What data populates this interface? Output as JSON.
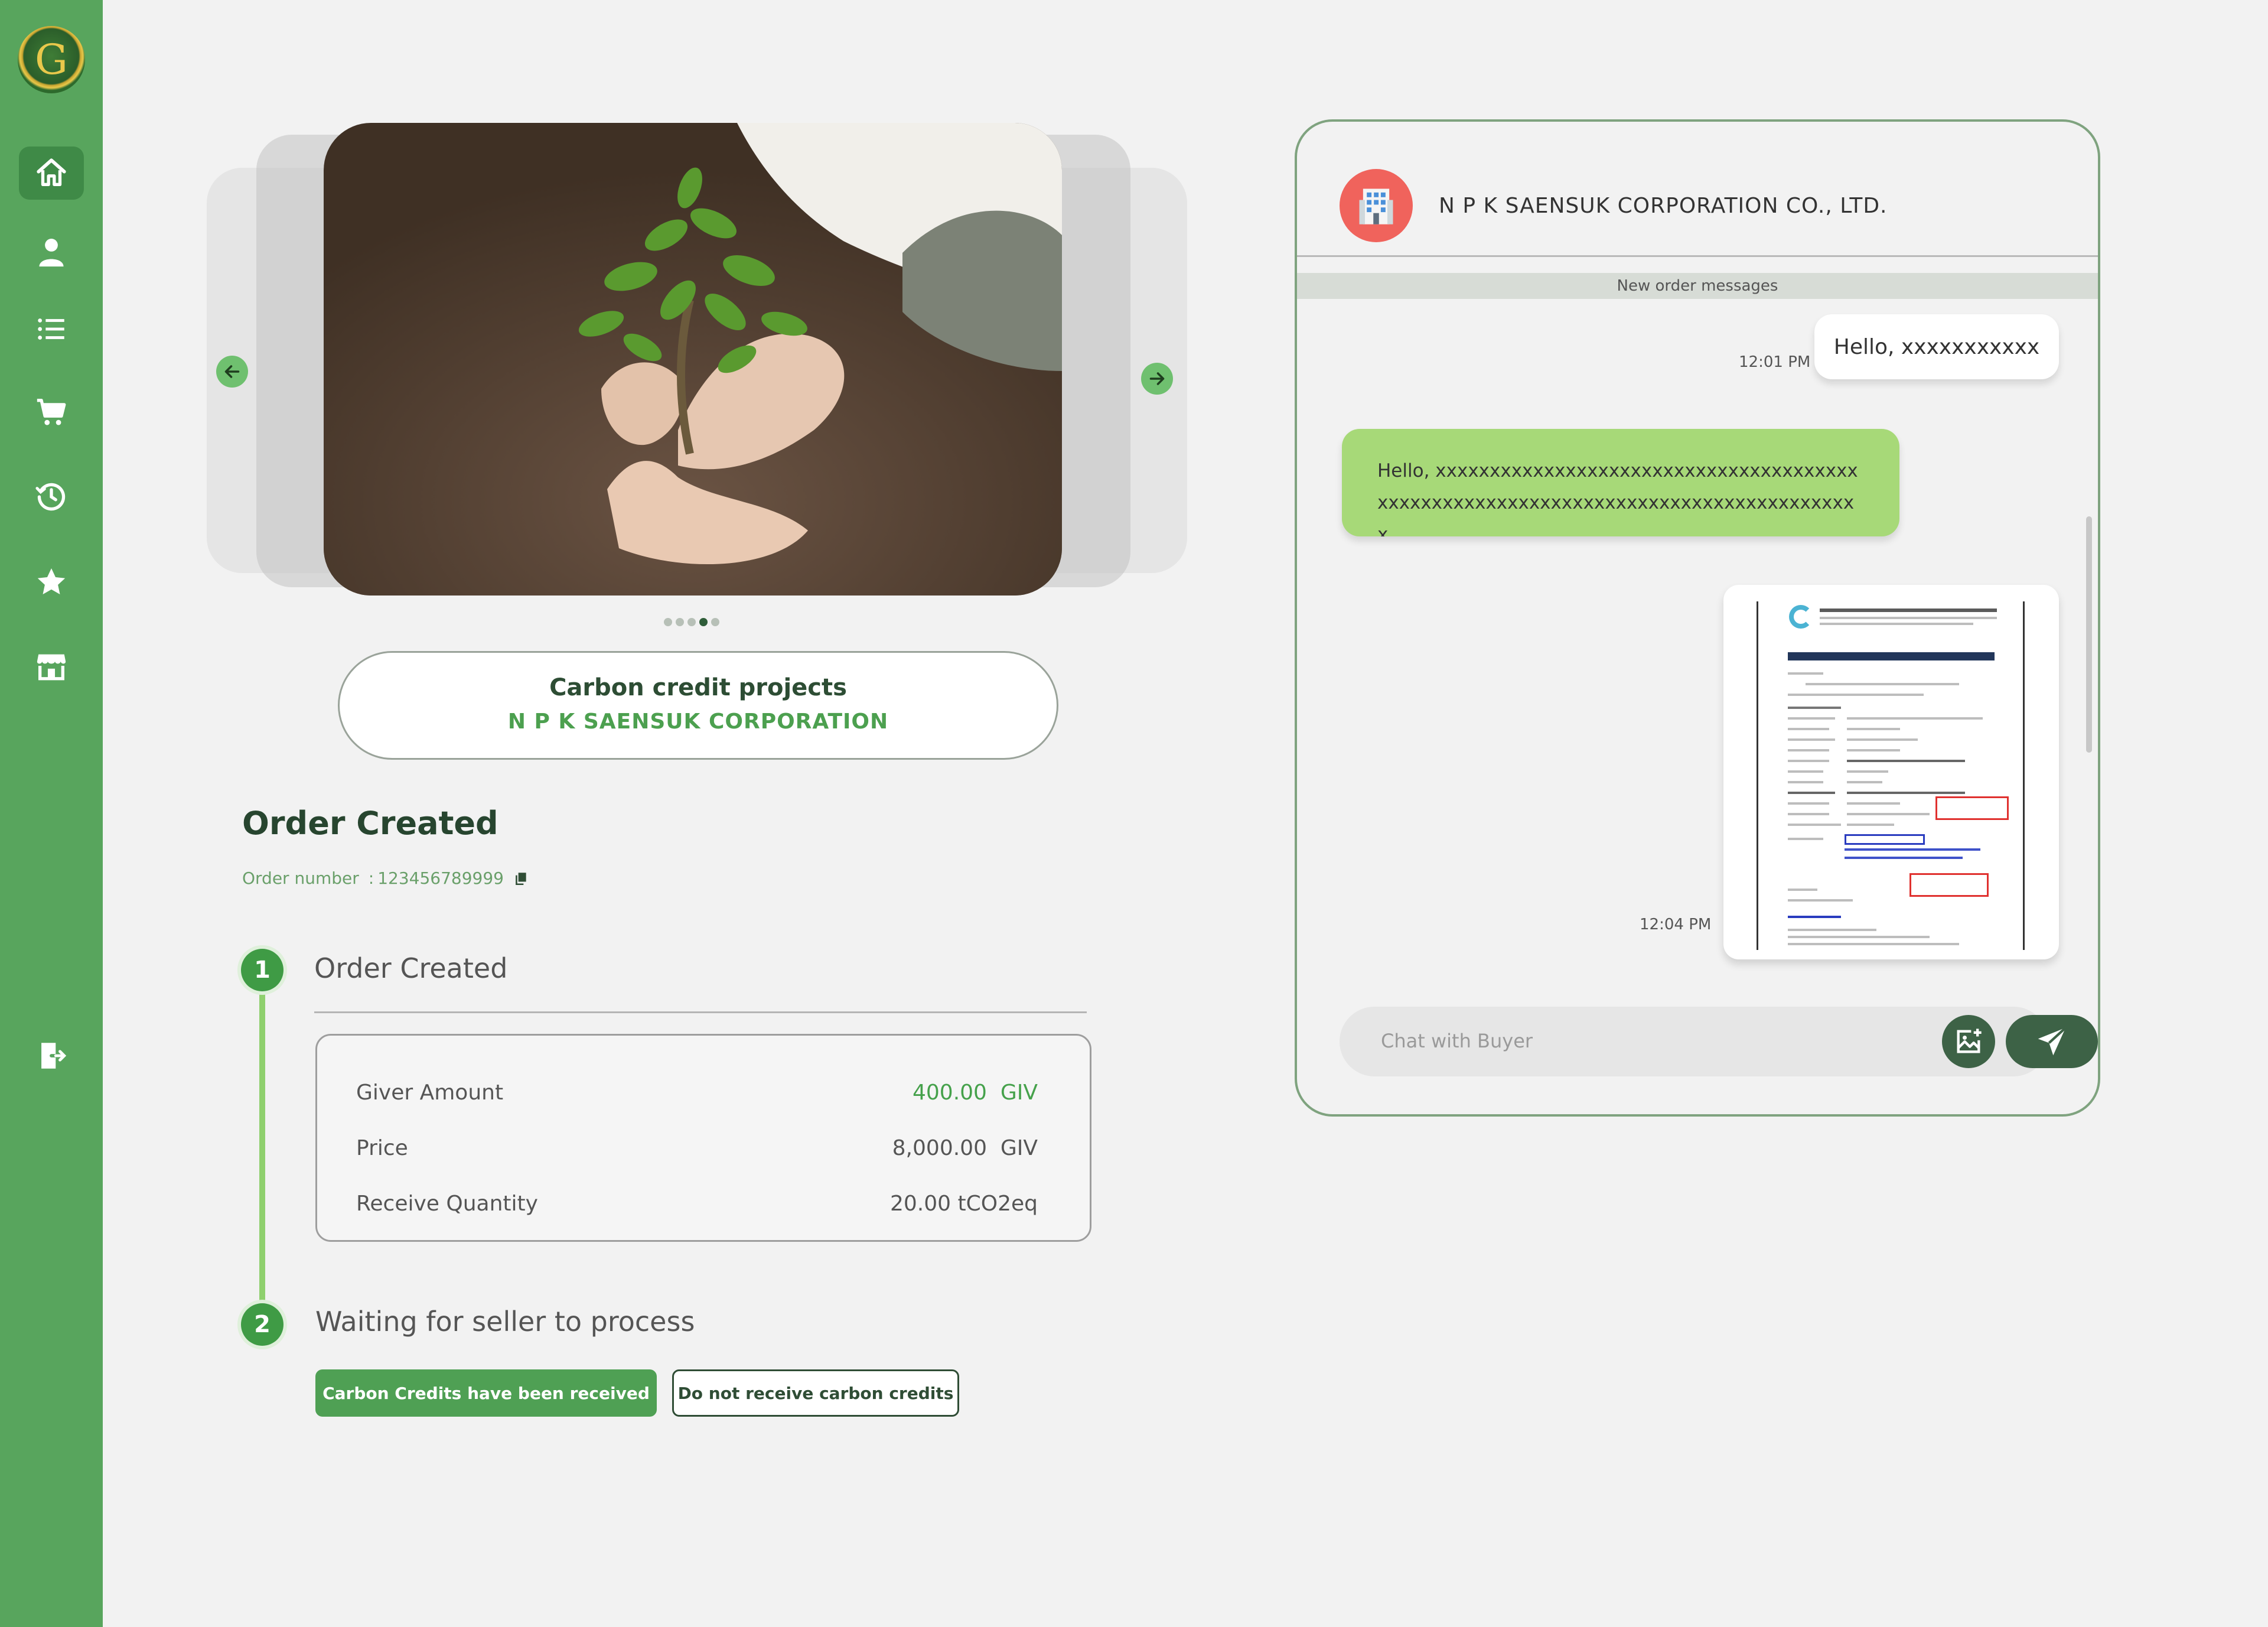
{
  "brand": {
    "logo_letter": "G"
  },
  "sidebar": {
    "items": [
      {
        "icon": "home-icon",
        "active": true
      },
      {
        "icon": "user-icon",
        "active": false
      },
      {
        "icon": "list-icon",
        "active": false
      },
      {
        "icon": "cart-icon",
        "active": false
      },
      {
        "icon": "history-icon",
        "active": false
      },
      {
        "icon": "star-icon",
        "active": false
      },
      {
        "icon": "store-icon",
        "active": false
      },
      {
        "icon": "logout-icon",
        "active": false
      }
    ]
  },
  "carousel": {
    "slide_count": 5,
    "active_index": 3
  },
  "project": {
    "title": "Carbon credit projects",
    "company": "N P K SAENSUK CORPORATION"
  },
  "order": {
    "heading": "Order Created",
    "number_label": "Order number",
    "number_sep": ":",
    "number_value": "123456789999"
  },
  "steps": [
    {
      "num": "1",
      "title": "Order Created"
    },
    {
      "num": "2",
      "title": "Waiting for seller to process"
    }
  ],
  "details": [
    {
      "label": "Giver Amount",
      "value": "400.00",
      "unit": "GIV",
      "highlight": true
    },
    {
      "label": "Price",
      "value": "8,000.00",
      "unit": "GIV",
      "highlight": false
    },
    {
      "label": "Receive Quantity",
      "value": "20.00",
      "unit": "tCO2eq",
      "highlight": false
    }
  ],
  "actions": {
    "received_label": "Carbon Credits have been received",
    "not_received_label": "Do not receive carbon credits"
  },
  "chat": {
    "company_name": "N P K SAENSUK CORPORATION CO., LTD.",
    "banner": "New order messages",
    "messages": [
      {
        "from": "self",
        "text": "Hello, xxxxxxxxxxx",
        "time": "12:01 PM"
      },
      {
        "from": "other",
        "text": "Hello, xxxxxxxxxxxxxxxxxxxxxxxxxxxxxxxxxxxxxxxxxxxxxxxxxxxxxxxxxxxxxxxxxxxxxxxxxxxxxxxxxxxx"
      },
      {
        "from": "self",
        "type": "document",
        "time": "12:04 PM"
      }
    ],
    "input_placeholder": "Chat with Buyer"
  },
  "colors": {
    "sidebar": "#58a55d",
    "accent_green": "#4fa054",
    "dark_green": "#3d6246",
    "bubble_green": "#a7d978",
    "avatar_red": "#f0635c"
  }
}
